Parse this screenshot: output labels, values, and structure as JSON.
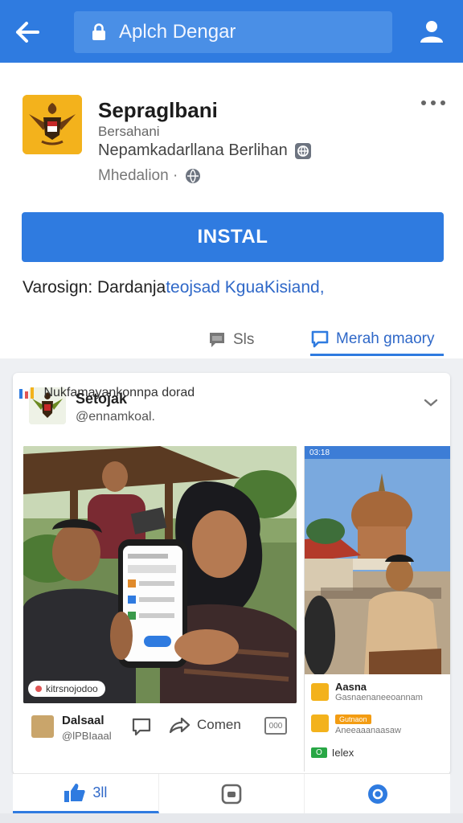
{
  "topbar": {
    "back_icon": "arrow-left-icon",
    "search_text": "Aplch Dengar",
    "lock_icon": "lock-icon",
    "profile_icon": "user-icon",
    "bg_color": "#2f7be0"
  },
  "app": {
    "name": "Sepraglbani",
    "sub1": "Bersahani",
    "sub2": "Nepamkadarllana Berlihan",
    "sub3": "Mhedalion ·",
    "install_label": "INSTAL",
    "version_prefix": "Varosign: Dardanja",
    "version_link": "teojsad KguaKisiand,",
    "tabs": [
      {
        "label": "Sls",
        "icon": "comment-icon",
        "active": false
      },
      {
        "label": "Merah gmaory",
        "icon": "message-icon",
        "active": true
      }
    ]
  },
  "post": {
    "author": "Setojak",
    "handle": "@ennamkoal.",
    "photo_tag": "kitrsnojodoo",
    "shot2_status": "03:18",
    "shot2_items": [
      {
        "title": "Aasna",
        "sub": "Gasnaenaneeoannam"
      },
      {
        "badge": "Gutnaon",
        "sub": "Aneeaaanaasaw"
      },
      {
        "green": "O",
        "label": "Ielex"
      }
    ],
    "footer_name": "Dalsaal",
    "footer_sub": "@lPBIaaal",
    "share_label": "Comen",
    "more_label": "000",
    "caption": "Nukfamayankonnpa dorad"
  },
  "bottom_nav": {
    "items": [
      {
        "label": "3ll",
        "icon": "thumbs-up-icon",
        "active": true
      },
      {
        "label": "",
        "icon": "app-square-icon",
        "active": false
      },
      {
        "label": "",
        "icon": "location-icon",
        "active": false
      }
    ]
  }
}
